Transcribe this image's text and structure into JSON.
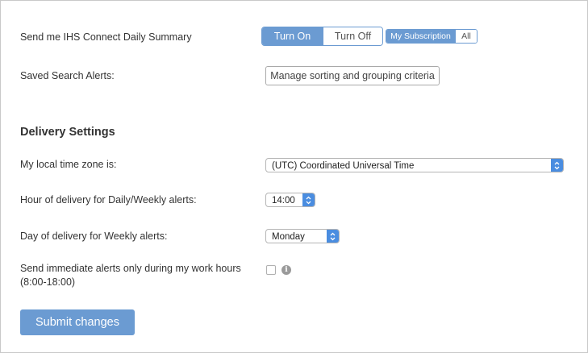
{
  "daily_summary": {
    "label": "Send me IHS Connect Daily Summary",
    "turn_on": "Turn On",
    "turn_off": "Turn Off",
    "selected": "Turn On",
    "scope_my_subscription": "My Subscription",
    "scope_all": "All",
    "scope_selected": "My Subscription"
  },
  "saved_search": {
    "label": "Saved Search Alerts:",
    "manage_button": "Manage sorting and grouping criteria"
  },
  "delivery": {
    "heading": "Delivery Settings",
    "timezone_label": "My local time zone is:",
    "timezone_value": "(UTC) Coordinated Universal Time",
    "hour_label": "Hour of delivery for Daily/Weekly alerts:",
    "hour_value": "14:00",
    "day_label": "Day of delivery for Weekly alerts:",
    "day_value": "Monday",
    "work_hours_label_line1": "Send immediate alerts only during my work hours",
    "work_hours_label_line2": "(8:00-18:00)",
    "work_hours_checked": false,
    "info_icon": "i"
  },
  "submit_label": "Submit changes",
  "colors": {
    "accent": "#6b9bd2",
    "select_arrow": "#4a8de0"
  },
  "icons": {
    "select_arrows": "select-arrows-icon",
    "info": "info-icon"
  }
}
